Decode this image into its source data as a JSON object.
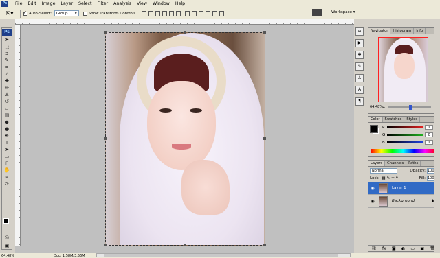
{
  "menubar": {
    "app_icon": "Ps",
    "items": [
      "File",
      "Edit",
      "Image",
      "Layer",
      "Select",
      "Filter",
      "Analysis",
      "View",
      "Window",
      "Help"
    ]
  },
  "options_bar": {
    "tool_icon": "move-tool-icon",
    "auto_select_label": "Auto-Select:",
    "auto_select_checked": true,
    "auto_select_value": "Group",
    "show_transform_label": "Show Transform Controls",
    "show_transform_checked": false,
    "workspace_label": "Workspace ▾"
  },
  "toolbox": {
    "logo": "Ps"
  },
  "navigator": {
    "tabs": [
      "Navigator",
      "Histogram",
      "Info"
    ],
    "zoom": "64.48%"
  },
  "color_panel": {
    "tabs": [
      "Color",
      "Swatches",
      "Styles"
    ],
    "channels": [
      {
        "label": "R",
        "value": "0",
        "color": "#e02020"
      },
      {
        "label": "G",
        "value": "0",
        "color": "#20b020"
      },
      {
        "label": "B",
        "value": "0",
        "color": "#2040e0"
      }
    ],
    "foreground": "#000000",
    "background": "#ffffff"
  },
  "layers_panel": {
    "tabs": [
      "Layers",
      "Channels",
      "Paths"
    ],
    "blend_mode": "Normal",
    "opacity_label": "Opacity:",
    "opacity_value": "100%",
    "lock_label": "Lock:",
    "fill_label": "Fill:",
    "fill_value": "100%",
    "layers": [
      {
        "name": "Layer 1",
        "selected": true,
        "locked": false
      },
      {
        "name": "Background",
        "selected": false,
        "locked": true
      }
    ],
    "footer_icons": [
      "link-icon",
      "fx-icon",
      "mask-icon",
      "adjustment-icon",
      "folder-icon",
      "new-layer-icon",
      "trash-icon"
    ]
  },
  "status_bar": {
    "zoom": "64.48%",
    "doc_info": "Doc: 1.58M/3.56M"
  }
}
